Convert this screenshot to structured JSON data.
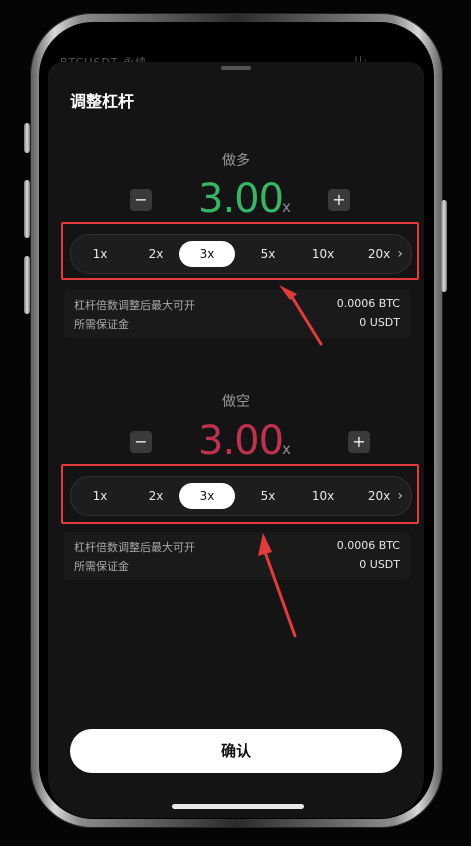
{
  "status_bar": {
    "left": "BTCUSDT 永续",
    "right": "||·"
  },
  "sheet": {
    "title": "调整杠杆"
  },
  "long": {
    "label": "做多",
    "value": "3.00",
    "unit": "x",
    "value_color": "#36b565",
    "options": [
      "1x",
      "2x",
      "3x",
      "5x",
      "10x",
      "20x"
    ],
    "selected": "3x",
    "info": {
      "max_open_label": "杠杆倍数调整后最大可开",
      "max_open_value": "0.0006 BTC",
      "margin_label": "所需保证金",
      "margin_value": "0 USDT"
    }
  },
  "short": {
    "label": "做空",
    "value": "3.00",
    "unit": "x",
    "value_color": "#c0304f",
    "options": [
      "1x",
      "2x",
      "3x",
      "5x",
      "10x",
      "20x"
    ],
    "selected": "3x",
    "info": {
      "max_open_label": "杠杆倍数调整后最大可开",
      "max_open_value": "0.0006 BTC",
      "margin_label": "所需保证金",
      "margin_value": "0 USDT"
    }
  },
  "confirm_label": "确认",
  "icons": {
    "minus": "minus-icon",
    "plus": "plus-icon",
    "more": "chevron-right-icon"
  },
  "highlight_color": "#e43a3a"
}
